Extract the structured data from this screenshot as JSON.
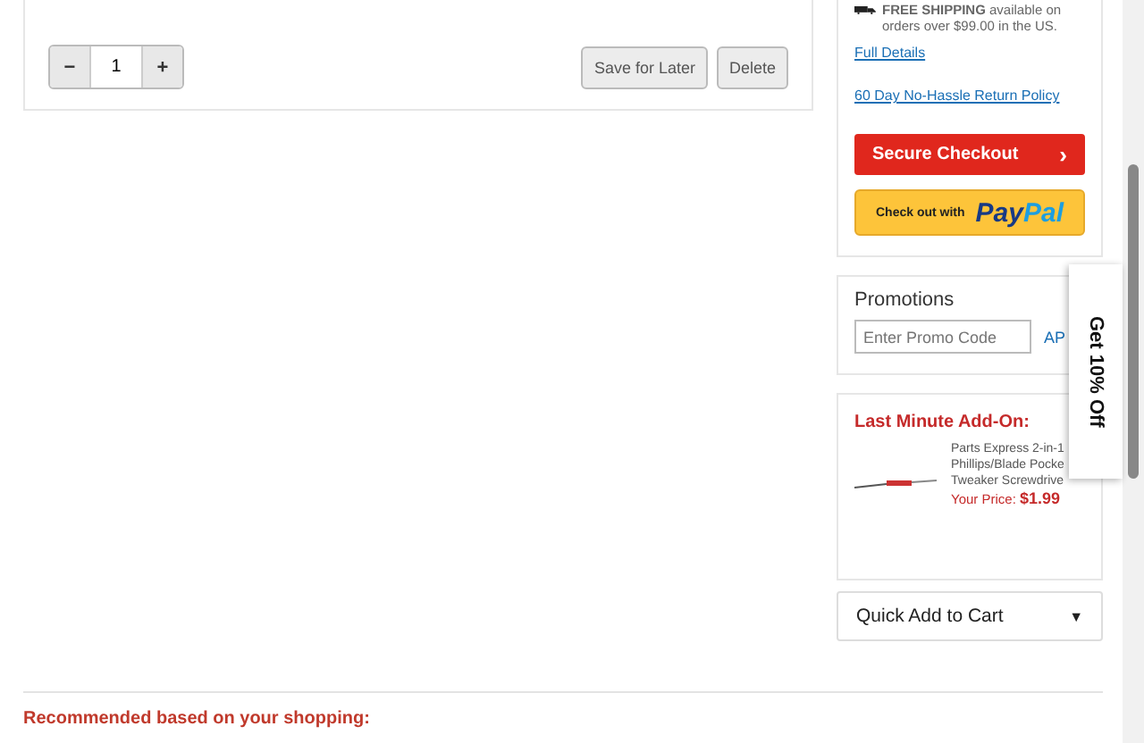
{
  "cart_item": {
    "quantity": "1",
    "decrement": "−",
    "increment": "+",
    "save_button": "Save for Later",
    "delete_button": "Delete"
  },
  "summary": {
    "shipping_note": "**FREE SHIPPING** available on orders over $99.00 in the US.",
    "full_details_link": "Full Details",
    "return_policy_link": "60 Day No-Hassle Return Policy",
    "checkout_button": "Secure Checkout",
    "checkout_chevron": "›",
    "paypal_prefix": "Check out with",
    "paypal_logo_dark": "Pay",
    "paypal_logo_light": "Pal"
  },
  "promotions": {
    "title": "Promotions",
    "placeholder": "Enter Promo Code",
    "apply_link": "AP"
  },
  "add_on": {
    "title": "Last Minute Add-On:",
    "product_name": [
      "Parts Express 2-in-1",
      "Phillips/Blade Pocke",
      "Tweaker Screwdrive"
    ],
    "price_label": "Your Price:",
    "price": "$1.99"
  },
  "quick_add": {
    "label": "Quick Add to Cart",
    "caret": "▼"
  },
  "discount_tab": {
    "label": "Get 10% Off"
  },
  "recommended_heading": "Recommended based on your shopping:"
}
